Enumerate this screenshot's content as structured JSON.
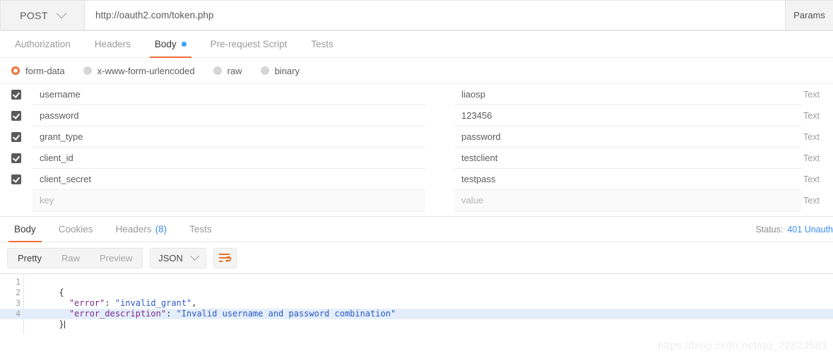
{
  "url_bar": {
    "method": "POST",
    "method_icon": "chevron-down-icon",
    "url": "http://oauth2.com/token.php",
    "params_label": "Params"
  },
  "request_tabs": [
    {
      "label": "Authorization",
      "active": false
    },
    {
      "label": "Headers",
      "active": false
    },
    {
      "label": "Body",
      "active": true,
      "dot": true
    },
    {
      "label": "Pre-request Script",
      "active": false
    },
    {
      "label": "Tests",
      "active": false
    }
  ],
  "body_types": [
    {
      "label": "form-data",
      "selected": true
    },
    {
      "label": "x-www-form-urlencoded",
      "selected": false
    },
    {
      "label": "raw",
      "selected": false
    },
    {
      "label": "binary",
      "selected": false
    }
  ],
  "form_rows": [
    {
      "checked": true,
      "key": "username",
      "value": "liaosp",
      "type": "Text"
    },
    {
      "checked": true,
      "key": "password",
      "value": "123456",
      "type": "Text"
    },
    {
      "checked": true,
      "key": "grant_type",
      "value": "password",
      "type": "Text"
    },
    {
      "checked": true,
      "key": "client_id",
      "value": "testclient",
      "type": "Text"
    },
    {
      "checked": true,
      "key": "client_secret",
      "value": "testpass",
      "type": "Text"
    }
  ],
  "form_placeholder_row": {
    "key_placeholder": "key",
    "value_placeholder": "value",
    "type": "Text"
  },
  "response_tabs": [
    {
      "label": "Body",
      "active": true
    },
    {
      "label": "Cookies",
      "active": false
    },
    {
      "label": "Headers",
      "active": false,
      "count": "(8)"
    },
    {
      "label": "Tests",
      "active": false
    }
  ],
  "status": {
    "label": "Status:",
    "value": "401 Unauth"
  },
  "view_toolbar": {
    "modes": [
      {
        "label": "Pretty",
        "active": true
      },
      {
        "label": "Raw",
        "active": false
      },
      {
        "label": "Preview",
        "active": false
      }
    ],
    "format": "JSON",
    "format_icon": "chevron-down-icon",
    "wrap_icon": "word-wrap-icon"
  },
  "code": {
    "lines": [
      {
        "num": "1",
        "fold": true,
        "highlight": false,
        "tokens": [
          {
            "t": "punct",
            "v": "{"
          }
        ]
      },
      {
        "num": "2",
        "fold": false,
        "highlight": false,
        "tokens": [
          {
            "t": "plain",
            "v": "  "
          },
          {
            "t": "key",
            "v": "\"error\""
          },
          {
            "t": "punct",
            "v": ": "
          },
          {
            "t": "str",
            "v": "\"invalid_grant\""
          },
          {
            "t": "punct",
            "v": ","
          }
        ]
      },
      {
        "num": "3",
        "fold": false,
        "highlight": false,
        "tokens": [
          {
            "t": "plain",
            "v": "  "
          },
          {
            "t": "key",
            "v": "\"error_description\""
          },
          {
            "t": "punct",
            "v": ": "
          },
          {
            "t": "str",
            "v": "\"Invalid username and password combination\""
          }
        ]
      },
      {
        "num": "4",
        "fold": false,
        "highlight": true,
        "tokens": [
          {
            "t": "punct",
            "v": "}"
          }
        ],
        "caret": true
      }
    ]
  },
  "watermark": "https://blog.csdn.net/qq_22823581"
}
